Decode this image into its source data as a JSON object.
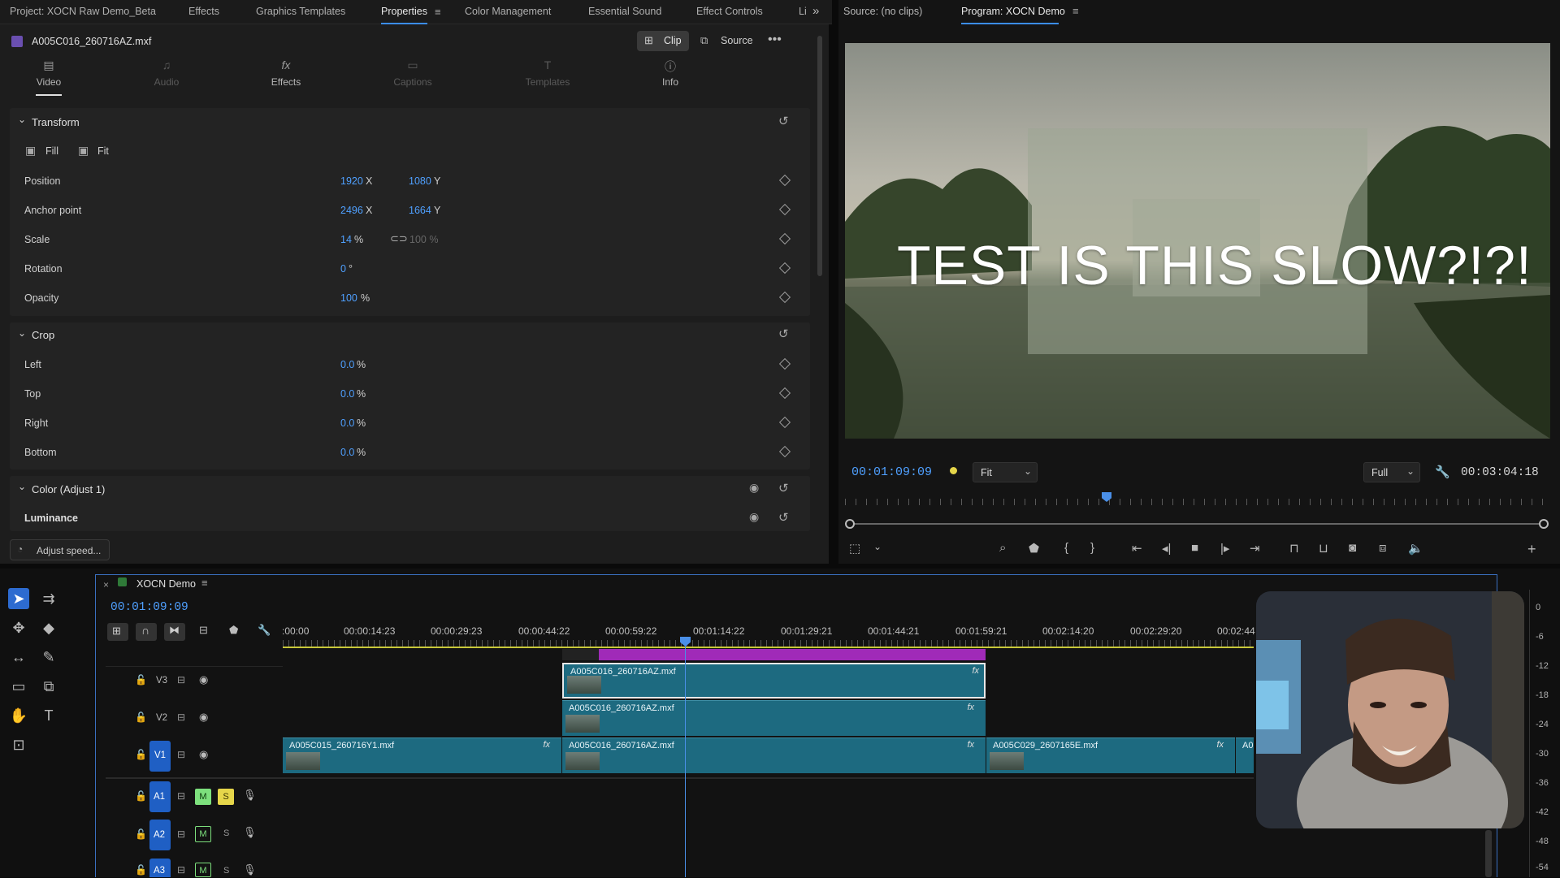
{
  "top_tabs": [
    "Project: XOCN Raw Demo_Beta",
    "Effects",
    "Graphics Templates",
    "Properties",
    "Color Management",
    "Essential Sound",
    "Effect Controls",
    "Li"
  ],
  "properties": {
    "file_name": "A005C016_260716AZ.mxf",
    "clip_btn": "Clip",
    "source_btn": "Source",
    "tabs": [
      {
        "label": "Video",
        "icon": "film-icon"
      },
      {
        "label": "Audio",
        "icon": "audio-icon"
      },
      {
        "label": "Effects",
        "icon": "fx-icon"
      },
      {
        "label": "Captions",
        "icon": "captions-icon"
      },
      {
        "label": "Templates",
        "icon": "templates-icon"
      },
      {
        "label": "Info",
        "icon": "info-icon"
      }
    ],
    "transform": {
      "title": "Transform",
      "fill": "Fill",
      "fit": "Fit",
      "position": {
        "label": "Position",
        "x": "1920",
        "y": "1080"
      },
      "anchor": {
        "label": "Anchor point",
        "x": "2496",
        "y": "1664"
      },
      "scale": {
        "label": "Scale",
        "value": "14",
        "unit": "%",
        "linked": "100 %"
      },
      "rotation": {
        "label": "Rotation",
        "value": "0",
        "unit": "°"
      },
      "opacity": {
        "label": "Opacity",
        "value": "100",
        "unit": "%"
      }
    },
    "crop": {
      "title": "Crop",
      "rows": [
        {
          "label": "Left",
          "value": "0.0",
          "unit": "%"
        },
        {
          "label": "Top",
          "value": "0.0",
          "unit": "%"
        },
        {
          "label": "Right",
          "value": "0.0",
          "unit": "%"
        },
        {
          "label": "Bottom",
          "value": "0.0",
          "unit": "%"
        }
      ]
    },
    "color": {
      "title": "Color (Adjust 1)",
      "luminance": "Luminance"
    },
    "adjust_speed": "Adjust speed..."
  },
  "monitor": {
    "source_tab": "Source: (no clips)",
    "program_tab": "Program: XOCN Demo",
    "overlay_text": "TEST IS THIS SLOW?!?!",
    "timecode": "00:01:09:09",
    "fit": "Fit",
    "quality": "Full",
    "duration": "00:03:04:18"
  },
  "timeline": {
    "sequence_name": "XOCN Demo",
    "timecode": "00:01:09:09",
    "ruler": [
      ":00:00",
      "00:00:14:23",
      "00:00:29:23",
      "00:00:44:22",
      "00:00:59:22",
      "00:01:14:22",
      "00:01:29:21",
      "00:01:44:21",
      "00:01:59:21",
      "00:02:14:20",
      "00:02:29:20",
      "00:02:44"
    ],
    "tracks": [
      {
        "name": "V3"
      },
      {
        "name": "V2"
      },
      {
        "name": "V1"
      },
      {
        "name": "A1",
        "m": "M",
        "s": "S"
      },
      {
        "name": "A2",
        "m": "M",
        "s": "S"
      },
      {
        "name": "A3",
        "m": "M",
        "s": "S"
      }
    ],
    "clips": {
      "v3": "A005C016_260716AZ.mxf",
      "v2": "A005C016_260716AZ.mxf",
      "v1a": "A005C015_260716Y1.mxf",
      "v1b": "A005C016_260716AZ.mxf",
      "v1c": "A005C029_2607165E.mxf",
      "v1d": "A0",
      "fx": "fx"
    },
    "meter_labels": [
      "0",
      "-6",
      "-12",
      "-18",
      "-24",
      "-30",
      "-36",
      "-42",
      "-48",
      "-54"
    ]
  },
  "colors": {
    "accent": "#3b8df0",
    "clip": "#1d6a80",
    "timecode": "#4fa0ff",
    "mute_green": "#7de07d",
    "solo_yellow": "#e6d64a"
  }
}
